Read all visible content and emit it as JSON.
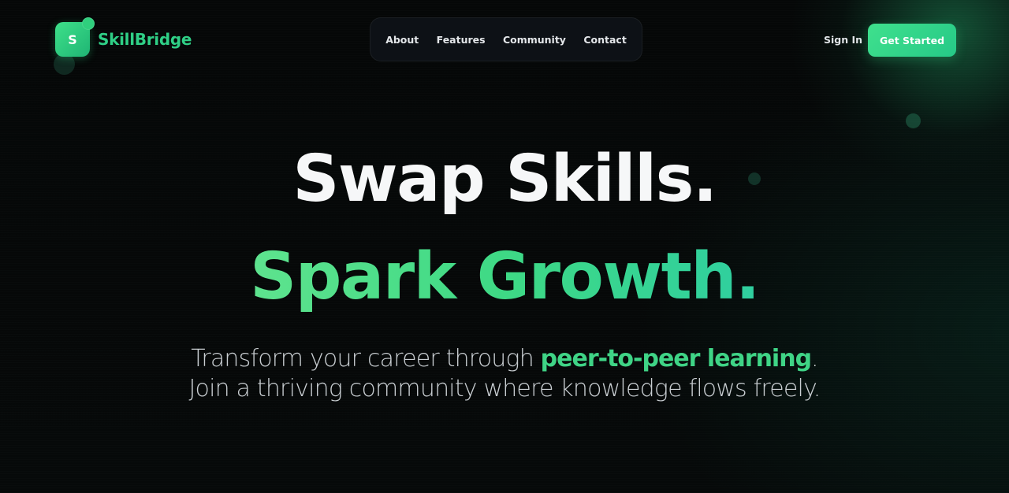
{
  "brand": {
    "logo_letter": "S",
    "name": "SkillBridge",
    "accent": "#2fcf86"
  },
  "nav": {
    "items": [
      {
        "label": "About"
      },
      {
        "label": "Features"
      },
      {
        "label": "Community"
      },
      {
        "label": "Contact"
      }
    ]
  },
  "header_actions": {
    "sign_in_label": "Sign In",
    "cta_label": "Get Started"
  },
  "hero": {
    "headline_line1": "Swap Skills.",
    "headline_line2": "Spark Growth.",
    "subtitle_prefix": "Transform your career through ",
    "subtitle_highlight": "peer-to-peer learning",
    "subtitle_suffix": ".",
    "subtitle_line2": "Join a thriving community where knowledge flows freely."
  },
  "colors": {
    "background": "#070a0a",
    "primary_green": "#3fe08d",
    "headline_white": "#f6f7f8",
    "subtitle_text": "#c9ced2"
  }
}
